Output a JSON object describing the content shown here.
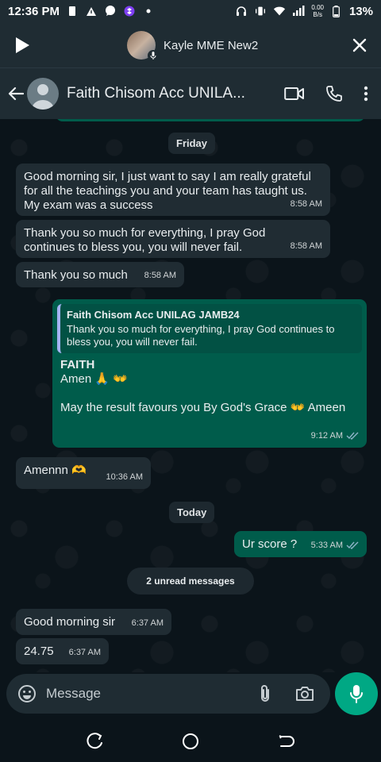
{
  "status": {
    "time": "12:36 PM",
    "net_speed_top": "0.00",
    "net_speed_unit": "B/s",
    "battery": "13%"
  },
  "call": {
    "name": "Kayle MME New2"
  },
  "header": {
    "title": "Faith Chisom Acc UNILA..."
  },
  "chat": {
    "day1": "Friday",
    "msg1": {
      "text": "Good morning sir, I just want to say I am really grateful for all the teachings you and your team has taught us. My exam was a success",
      "time": "8:58 AM"
    },
    "msg2": {
      "text": "Thank you so much for everything, I pray God continues to bless you, you will never fail.",
      "time": "8:58 AM"
    },
    "msg3": {
      "text": "Thank you so much",
      "time": "8:58 AM"
    },
    "reply": {
      "quote_name": "Faith Chisom Acc UNILAG JAMB24",
      "quote_text": "Thank you so much for everything, I pray God continues to bless you, you will never fail.",
      "sender": "FAITH",
      "line1": "Amen 🙏 👐",
      "line2": "May the result favours you By God's Grace 👐 Ameen",
      "time": "9:12 AM"
    },
    "msg5": {
      "text": "Amennn 🫶",
      "time": "10:36 AM"
    },
    "day2": "Today",
    "msg6": {
      "text": "Ur score ?",
      "time": "5:33 AM"
    },
    "unread": "2 unread messages",
    "msg7": {
      "text": "Good morning sir",
      "time": "6:37 AM"
    },
    "msg8": {
      "text": "24.75",
      "time": "6:37 AM"
    }
  },
  "composer": {
    "placeholder": "Message"
  },
  "colors": {
    "incoming": "#202c33",
    "outgoing": "#005c4b",
    "accent": "#00a884",
    "background": "#0b141a"
  }
}
